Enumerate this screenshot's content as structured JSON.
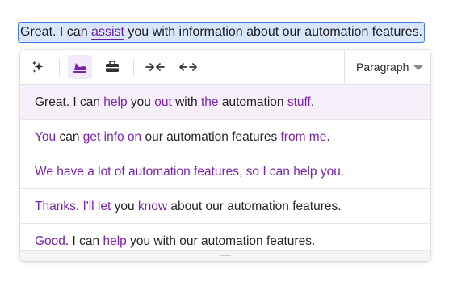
{
  "selection": {
    "before": "Great. I can ",
    "highlight": "assist",
    "after": " you with information about our automation features."
  },
  "toolbar": {
    "buttons": [
      {
        "icon": "sparkles-icon",
        "active": false
      },
      {
        "icon": "casual-tone-icon",
        "active": true
      },
      {
        "icon": "briefcase-icon",
        "active": false
      },
      {
        "icon": "shorten-icon",
        "active": false
      },
      {
        "icon": "expand-icon",
        "active": false
      }
    ],
    "paragraph_label": "Paragraph"
  },
  "suggestions": [
    {
      "active": true,
      "segments": [
        {
          "t": "Great. I can ",
          "c": false
        },
        {
          "t": "help",
          "c": true
        },
        {
          "t": " you ",
          "c": false
        },
        {
          "t": "out",
          "c": true
        },
        {
          "t": " with ",
          "c": false
        },
        {
          "t": "the",
          "c": true
        },
        {
          "t": " automation ",
          "c": false
        },
        {
          "t": "stuff",
          "c": true
        },
        {
          "t": ".",
          "c": false
        }
      ]
    },
    {
      "active": false,
      "segments": [
        {
          "t": "You",
          "c": true
        },
        {
          "t": " can ",
          "c": false
        },
        {
          "t": "get info on",
          "c": true
        },
        {
          "t": " our automation features ",
          "c": false
        },
        {
          "t": "from me",
          "c": true
        },
        {
          "t": ".",
          "c": false
        }
      ]
    },
    {
      "active": false,
      "segments": [
        {
          "t": "We have a lot of automation features, so I can help you",
          "c": true
        },
        {
          "t": ".",
          "c": false
        }
      ]
    },
    {
      "active": false,
      "segments": [
        {
          "t": "Thanks",
          "c": true
        },
        {
          "t": ". ",
          "c": false
        },
        {
          "t": "I'll let",
          "c": true
        },
        {
          "t": " you ",
          "c": false
        },
        {
          "t": "know",
          "c": true
        },
        {
          "t": " about our automation features.",
          "c": false
        }
      ]
    },
    {
      "active": false,
      "segments": [
        {
          "t": "Good",
          "c": true
        },
        {
          "t": ". I can ",
          "c": false
        },
        {
          "t": "help",
          "c": true
        },
        {
          "t": " you with our automation features.",
          "c": false
        }
      ]
    }
  ]
}
